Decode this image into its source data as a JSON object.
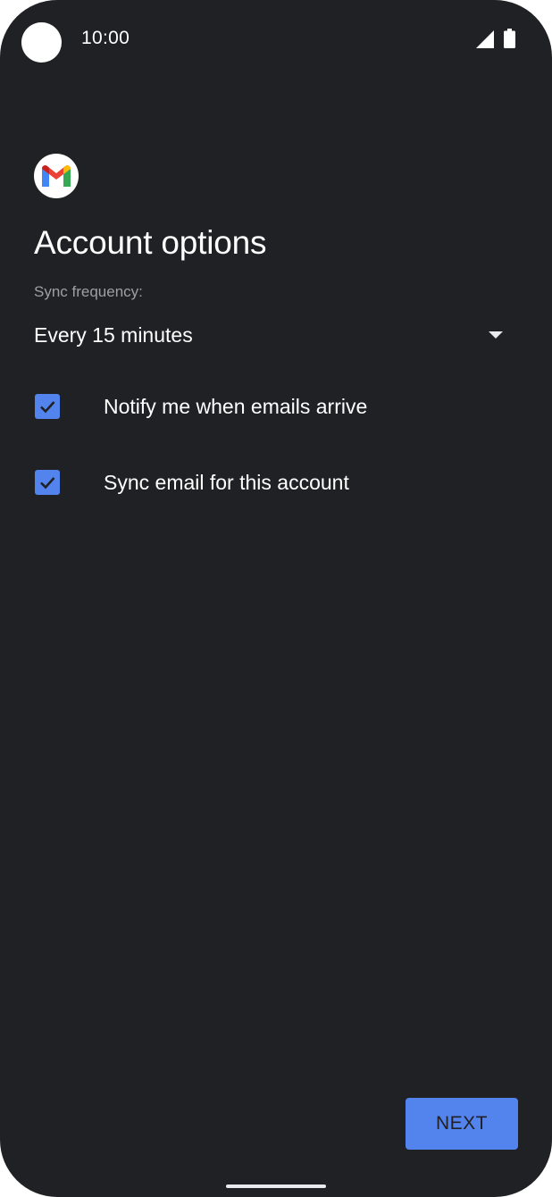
{
  "status_bar": {
    "time": "10:00",
    "icons": [
      "camera-cutout",
      "signal-icon",
      "battery-icon"
    ]
  },
  "app": {
    "logo_icon": "gmail-logo-icon"
  },
  "page": {
    "title": "Account options"
  },
  "sync": {
    "label": "Sync frequency:",
    "value": "Every 15 minutes"
  },
  "options": [
    {
      "label": "Notify me when emails arrive",
      "checked": true
    },
    {
      "label": "Sync email for this account",
      "checked": true
    }
  ],
  "actions": {
    "next_label": "NEXT"
  },
  "colors": {
    "background": "#202124",
    "accent": "#5383ec",
    "text_primary": "#ffffff",
    "text_secondary": "#9aa0a6"
  }
}
